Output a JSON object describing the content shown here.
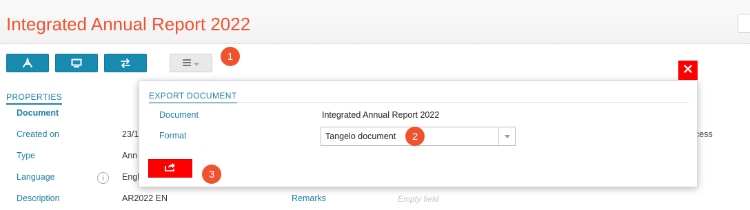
{
  "page": {
    "title": "Integrated Annual Report 2022"
  },
  "toolbar": {
    "buttons": [
      {
        "icon": "pdf-icon"
      },
      {
        "icon": "monitor-icon"
      },
      {
        "icon": "swap-arrows-icon"
      }
    ],
    "menu_icon": "hamburger-menu-icon"
  },
  "callouts": [
    "1",
    "2",
    "3"
  ],
  "properties": {
    "tab_label": "PROPERTIES",
    "rows": [
      {
        "label": "Document",
        "value": ""
      },
      {
        "label": "Created on",
        "value": "23/1"
      },
      {
        "label": "Type",
        "value": "Ann"
      },
      {
        "label": "Language",
        "value": "Engl"
      },
      {
        "label": "Description",
        "value": "AR2022 EN"
      }
    ],
    "remarks_label": "Remarks",
    "remarks_placeholder": "Empty field",
    "right_column_partial": "cess"
  },
  "dialog": {
    "title": "EXPORT DOCUMENT",
    "document_label": "Document",
    "document_value": "Integrated Annual Report 2022",
    "format_label": "Format",
    "format_value": "Tangelo document",
    "export_icon": "export-share-icon",
    "close_icon": "close-icon"
  },
  "colors": {
    "accent": "#1a8bb0",
    "title": "#f0522e",
    "danger": "#ff0000",
    "callout": "#f0522e"
  }
}
